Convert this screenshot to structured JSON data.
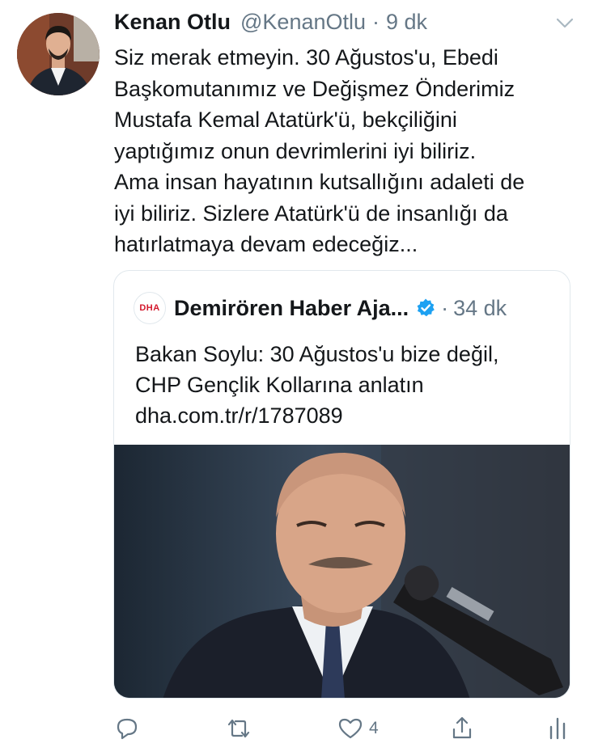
{
  "tweet": {
    "author_name": "Kenan Otlu",
    "author_handle": "@KenanOtlu",
    "separator": "·",
    "time": "9 dk",
    "text_lines": [
      "Siz merak etmeyin. 30 Ağustos'u, Ebedi",
      "Başkomutanımız ve Değişmez Önderimiz",
      "Mustafa Kemal Atatürk'ü, bekçiliğini",
      "yaptığımız onun devrimlerini iyi biliriz.",
      "Ama insan hayatının kutsallığını adaleti de",
      "iyi biliriz. Sizlere Atatürk'ü de insanlığı da",
      "hatırlatmaya devam edeceğiz..."
    ]
  },
  "quote": {
    "logo_text": "DHA",
    "author_name": "Demirören Haber Aja...",
    "separator": "·",
    "time": "34 dk",
    "text_lines": [
      "Bakan Soylu: 30 Ağustos'u bize değil,",
      "CHP Gençlik Kollarına anlatın",
      "dha.com.tr/r/1787089"
    ]
  },
  "actions": {
    "like_count": "4"
  },
  "icons": {
    "menu": "chevron-down-icon",
    "verified": "verified-badge-icon",
    "reply": "reply-icon",
    "retweet": "retweet-icon",
    "like": "heart-icon",
    "share": "share-icon",
    "analytics": "analytics-icon"
  },
  "colors": {
    "text": "#14171a",
    "secondary": "#657786",
    "verified": "#1da1f2",
    "border": "#e1e8ed",
    "dha_red": "#d3172b"
  }
}
